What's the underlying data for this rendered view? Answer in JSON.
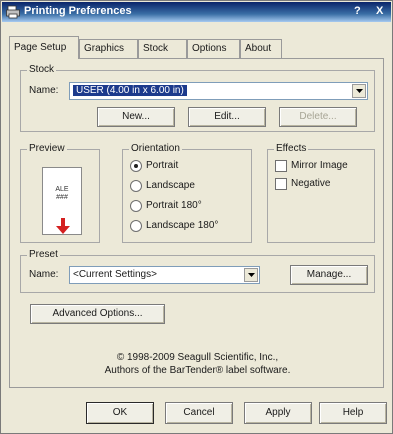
{
  "window": {
    "title": "Printing Preferences",
    "help_glyph": "?",
    "close_glyph": "X"
  },
  "tabs": [
    {
      "label": "Page Setup",
      "active": true
    },
    {
      "label": "Graphics"
    },
    {
      "label": "Stock"
    },
    {
      "label": "Options"
    },
    {
      "label": "About"
    }
  ],
  "stock": {
    "group_label": "Stock",
    "name_label": "Name:",
    "name_value": "USER (4.00 in x 6.00 in)",
    "new_button": "New...",
    "edit_button": "Edit...",
    "delete_button": "Delete..."
  },
  "preview": {
    "group_label": "Preview",
    "label_text_top": "ALE",
    "label_text_bottom": "###"
  },
  "orientation": {
    "group_label": "Orientation",
    "options": [
      "Portrait",
      "Landscape",
      "Portrait 180°",
      "Landscape 180°"
    ],
    "selected": "Portrait"
  },
  "effects": {
    "group_label": "Effects",
    "options": [
      "Mirror Image",
      "Negative"
    ]
  },
  "preset": {
    "group_label": "Preset",
    "name_label": "Name:",
    "name_value": "<Current Settings>",
    "manage_button": "Manage..."
  },
  "advanced_button": "Advanced Options...",
  "copyright": {
    "line1": "© 1998-2009 Seagull Scientific, Inc.,",
    "line2": "Authors of the BarTender® label software."
  },
  "footer": {
    "ok": "OK",
    "cancel": "Cancel",
    "apply": "Apply",
    "help": "Help"
  },
  "colors": {
    "titlebar": "#0a246a",
    "selection": "#1c3a8c",
    "accent_arrow": "#d42020"
  }
}
